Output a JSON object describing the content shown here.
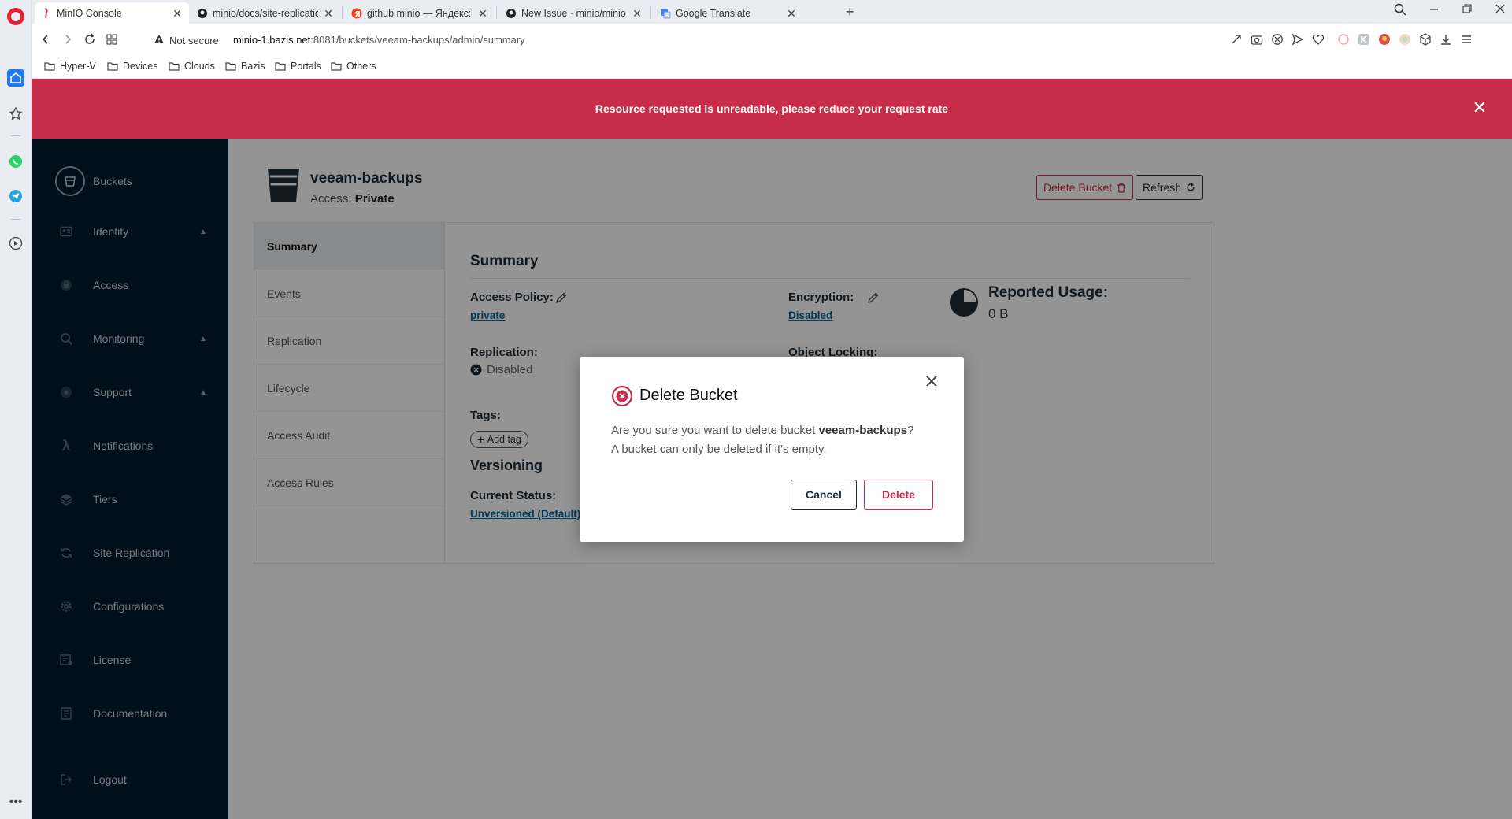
{
  "browser": {
    "tabs": [
      {
        "title": "MinIO Console",
        "icon": "minio-flamingo-icon"
      },
      {
        "title": "minio/docs/site-replication",
        "icon": "github-icon"
      },
      {
        "title": "github minio — Яндекс: на",
        "icon": "yandex-icon"
      },
      {
        "title": "New Issue · minio/minio",
        "icon": "github-icon"
      },
      {
        "title": "Google Translate",
        "icon": "google-translate-icon"
      }
    ],
    "security_label": "Not secure",
    "url_host": "minio-1.bazis.net",
    "url_rest": ":8081/buckets/veeam-backups/admin/summary",
    "bookmarks": [
      "Hyper-V",
      "Devices",
      "Clouds",
      "Bazis",
      "Portals",
      "Others"
    ]
  },
  "alert": {
    "message": "Resource requested is unreadable, please reduce your request rate",
    "color": "#c72c48"
  },
  "sidebar": {
    "items": [
      {
        "label": "Buckets",
        "icon": "bucket-icon",
        "expandable": false
      },
      {
        "label": "Identity",
        "icon": "identity-card-icon",
        "expandable": true
      },
      {
        "label": "Access",
        "icon": "lock-icon",
        "expandable": false
      },
      {
        "label": "Monitoring",
        "icon": "magnifier-icon",
        "expandable": true
      },
      {
        "label": "Support",
        "icon": "support-icon",
        "expandable": true
      },
      {
        "label": "Notifications",
        "icon": "lambda-icon",
        "expandable": false
      },
      {
        "label": "Tiers",
        "icon": "stack-icon",
        "expandable": false
      },
      {
        "label": "Site Replication",
        "icon": "replication-icon",
        "expandable": false
      },
      {
        "label": "Configurations",
        "icon": "gear-icon",
        "expandable": false
      },
      {
        "label": "License",
        "icon": "license-icon",
        "expandable": false
      },
      {
        "label": "Documentation",
        "icon": "document-icon",
        "expandable": false
      },
      {
        "label": "Logout",
        "icon": "logout-icon",
        "expandable": false
      }
    ],
    "background": "#001c2e"
  },
  "bucket": {
    "name": "veeam-backups",
    "access_prefix": "Access: ",
    "access_value": "Private",
    "delete_label": "Delete Bucket",
    "refresh_label": "Refresh"
  },
  "tabs": [
    "Summary",
    "Events",
    "Replication",
    "Lifecycle",
    "Access Audit",
    "Access Rules"
  ],
  "summary": {
    "title": "Summary",
    "access_policy_label": "Access Policy:",
    "access_policy_value": "private",
    "encryption_label": "Encryption:",
    "encryption_value": "Disabled",
    "reported_usage_label": "Reported Usage:",
    "reported_usage_value": "0 B",
    "replication_label": "Replication:",
    "replication_value": "Disabled",
    "object_locking_label": "Object Locking:",
    "tags_label": "Tags:",
    "add_tag_label": "Add tag",
    "versioning_title": "Versioning",
    "current_status_label": "Current Status:",
    "current_status_value": "Unversioned (Default)"
  },
  "modal": {
    "title": "Delete Bucket",
    "body_prefix": "Are you sure you want to delete bucket ",
    "body_bucket": "veeam-backups",
    "body_suffix": "?",
    "body_line2": "A bucket can only be deleted if it's empty.",
    "cancel_label": "Cancel",
    "delete_label": "Delete",
    "accent": "#c72c48"
  }
}
